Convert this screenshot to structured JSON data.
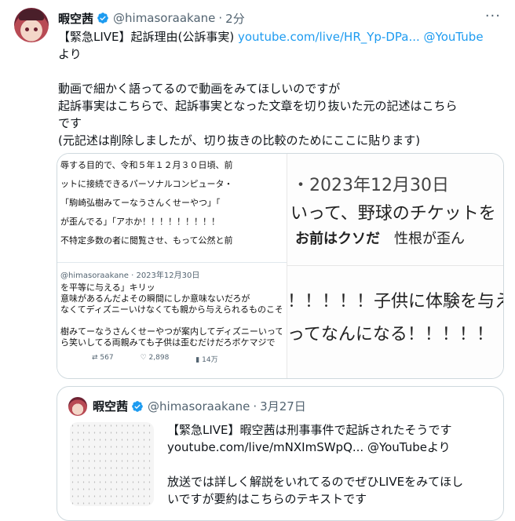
{
  "tweet": {
    "author_name": "暇空茜",
    "author_handle": "@himasoraakane",
    "separator": "·",
    "time": "2分",
    "body": {
      "line1_prefix": "【緊急LIVE】起訴理由(公訴事実) ",
      "line1_link": "youtube.com/live/HR_Yp-DPa...",
      "line1_suffix": " @YouTube",
      "line2": "より",
      "line3": "動画で細かく語ってるので動画をみてほしいのですが",
      "line4": "起訴事実はこちらで、起訴事実となった文章を切り抜いた元の記述はこちら",
      "line5": "です",
      "line6": "(元記述は削除しましたが、切り抜きの比較のためにここに貼ります)"
    }
  },
  "media": {
    "left_top_lines": [
      "辱する目的で、令和５年１２月３０日頃、前",
      "ットに接続できるパーソナルコンピュータ・",
      "「駒崎弘樹みてーなうさんくせーやつ」「",
      "が歪んでる」「アホか！！！！！！！！！",
      "不特定多数の者に閲覧させ、もって公然と前"
    ],
    "left_handle": "@himasoraakane · 2023年12月30日",
    "left_bottom_lines": [
      "を平等に与える」キリッ",
      "意味があるんだよその瞬間にしか意味ないだろが",
      "なくてディズニーいけなくても親から与えられるものこそ",
      "",
      "樹みてーなうさんくせーやつが案内してディズニーいって",
      "ら笑いしてる両親みても子供は歪むだけだろボケマジで"
    ],
    "stats": {
      "retweets": "567",
      "likes": "2,898",
      "views": "14万"
    },
    "right_date": "・2023年12月30日",
    "right_line1": "いって、野球のチケットを",
    "right_line2_bold": "お前はクソだ",
    "right_line2_rest": "　性根が歪ん",
    "right_line3": "！！！！！子供に体験を与え",
    "right_line4": "ってなんになる！！！！！"
  },
  "quote": {
    "author_name": "暇空茜",
    "author_handle": "@himasoraakane",
    "separator": "·",
    "date": "3月27日",
    "line1": "【緊急LIVE】暇空茜は刑事事件で起訴されたそうです",
    "line2": "youtube.com/live/mNXImSWpQ... @YouTubeより",
    "line3": "放送では詳しく解説をいれてるのでぜひLIVEをみてほし",
    "line4": "いですが要約はこちらのテキストです"
  },
  "colors": {
    "link": "#1d9bf0",
    "verified": "#1d9bf0",
    "muted": "#536471",
    "border": "#cfd9de"
  }
}
